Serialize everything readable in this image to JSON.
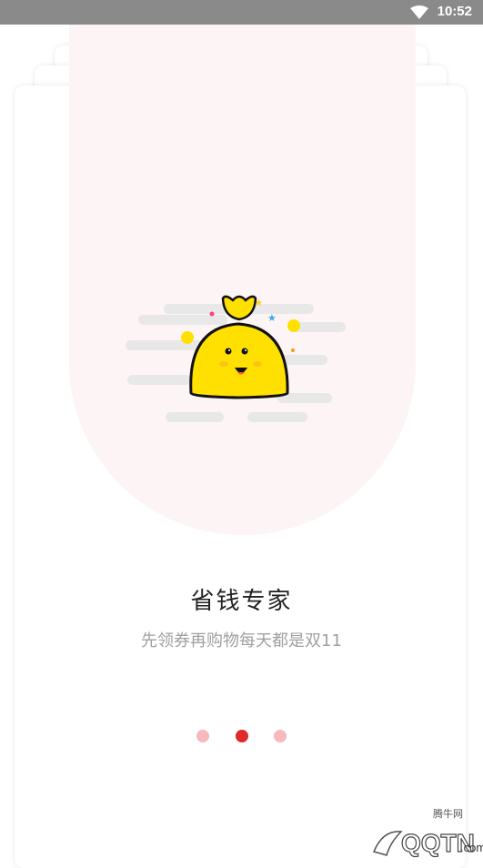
{
  "status_bar": {
    "time": "10:52",
    "wifi_icon": "wifi-icon"
  },
  "onboarding": {
    "title": "省钱专家",
    "subtitle": "先领券再购物每天都是双11",
    "page_count": 3,
    "active_page": 2
  },
  "watermark": {
    "text": "腾牛网",
    "logo_text": "QQTN.com"
  },
  "colors": {
    "accent": "#e02a2a",
    "dot_inactive": "#f6b9bd",
    "mascot": "#ffe000",
    "arch": "#fdf5f5"
  }
}
